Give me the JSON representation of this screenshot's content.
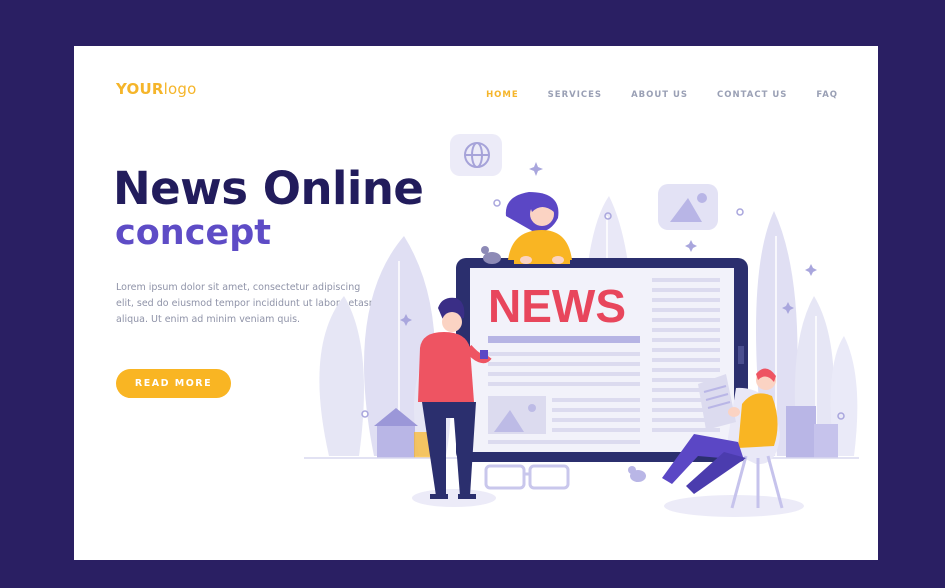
{
  "logo": {
    "bold": "YOUR",
    "rest": "logo"
  },
  "nav": {
    "home": "HOME",
    "services": "SERVICES",
    "about": "ABOUT US",
    "contact": "CONTACT US",
    "faq": "FAQ"
  },
  "hero": {
    "title_line1": "News Online",
    "title_line2": "concept",
    "paragraph": "Lorem ipsum dolor sit amet, consectetur adipiscing elit, sed do eiusmod tempor incididunt ut labore etasn aliqua. Ut enim ad minim veniam quis.",
    "cta": "READ MORE"
  },
  "illustration": {
    "screen_headline": "NEWS"
  },
  "colors": {
    "background": "#2a1f63",
    "accent": "#f9b523",
    "title": "#221c5c",
    "subtitle": "#5e4cc6",
    "news_red": "#e8465c"
  }
}
